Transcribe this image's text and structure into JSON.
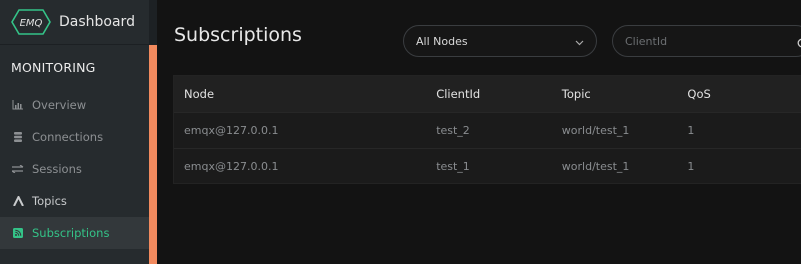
{
  "brand": {
    "logo_text": "EMQ",
    "title": "Dashboard"
  },
  "sidebar": {
    "section": "MONITORING",
    "items": [
      {
        "label": "Overview",
        "icon": "bar-chart-icon"
      },
      {
        "label": "Connections",
        "icon": "database-icon"
      },
      {
        "label": "Sessions",
        "icon": "swap-icon"
      },
      {
        "label": "Topics",
        "icon": "fork-icon"
      },
      {
        "label": "Subscriptions",
        "icon": "rss-icon",
        "active": true
      }
    ]
  },
  "main": {
    "title": "Subscriptions",
    "node_select": {
      "value": "All Nodes"
    },
    "search": {
      "placeholder": "ClientId"
    },
    "table": {
      "headers": [
        "Node",
        "ClientId",
        "Topic",
        "QoS"
      ],
      "rows": [
        [
          "emqx@127.0.0.1",
          "test_2",
          "world/test_1",
          "1"
        ],
        [
          "emqx@127.0.0.1",
          "test_1",
          "world/test_1",
          "1"
        ]
      ]
    }
  },
  "colors": {
    "accent": "#34c388",
    "scroll": "#f28a5e",
    "sidebar": "#262b2e",
    "background": "#131313"
  }
}
